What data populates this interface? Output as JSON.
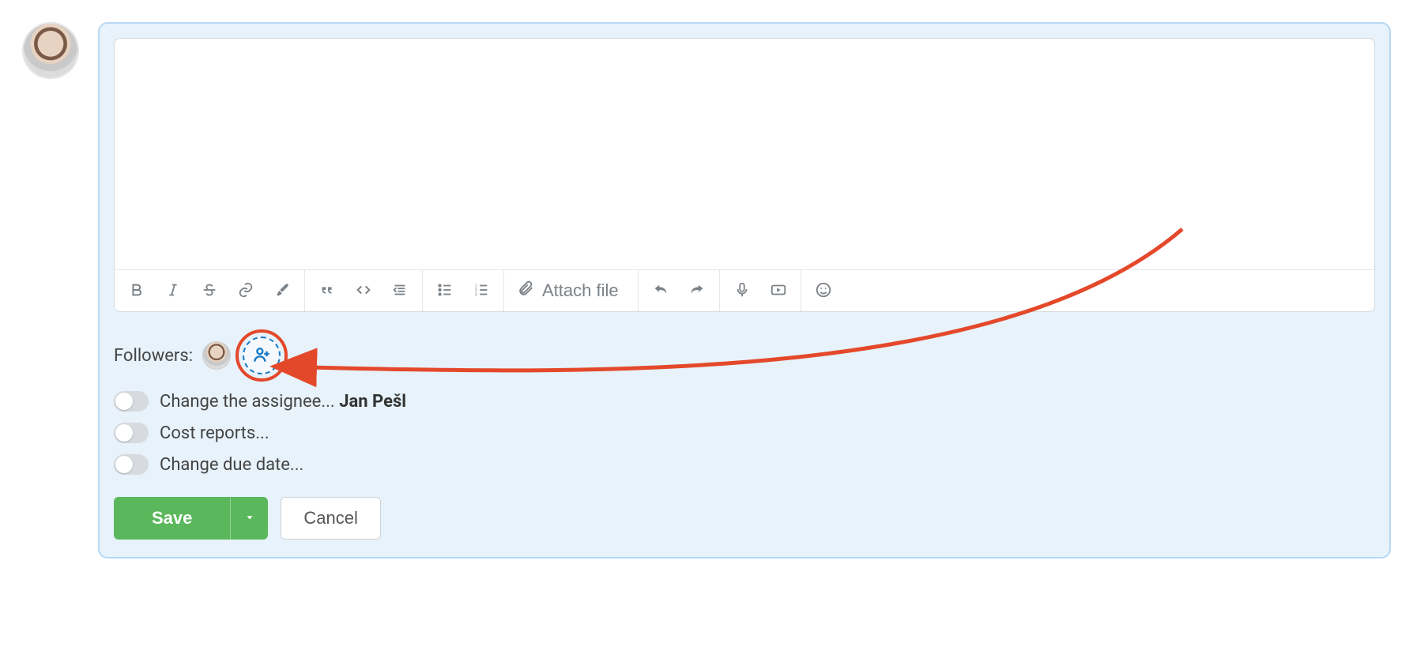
{
  "toolbar": {
    "attach_label": "Attach file"
  },
  "followers": {
    "label": "Followers:"
  },
  "options": {
    "change_assignee_prefix": "Change the assignee... ",
    "change_assignee_name": "Jan Pešl",
    "cost_reports": "Cost reports...",
    "change_due_date": "Change due date..."
  },
  "buttons": {
    "save": "Save",
    "cancel": "Cancel"
  }
}
